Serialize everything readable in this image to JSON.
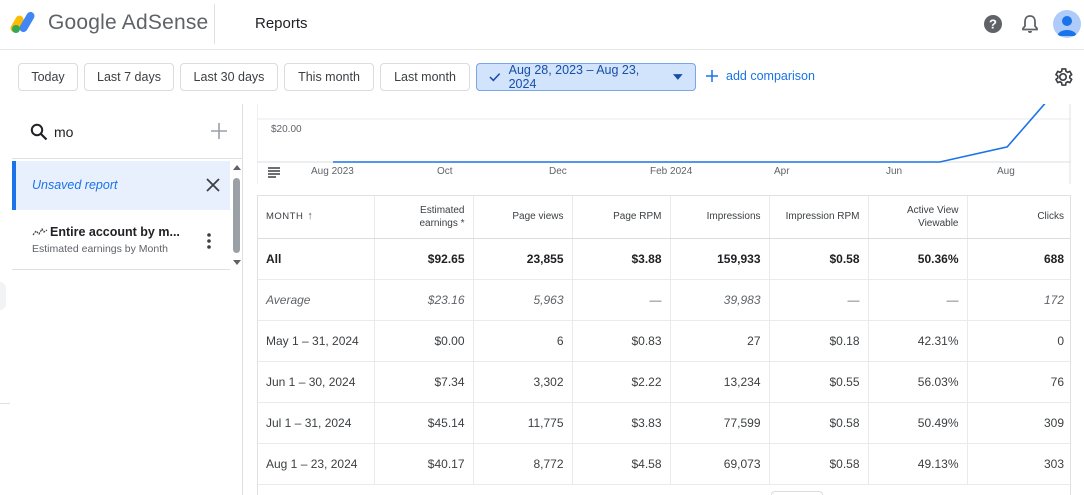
{
  "header": {
    "brand": "Google AdSense",
    "page_title": "Reports",
    "icons": [
      "help-icon",
      "notifications-icon",
      "account-avatar"
    ]
  },
  "filters": {
    "chips": [
      "Today",
      "Last 7 days",
      "Last 30 days",
      "This month",
      "Last month"
    ],
    "active_range": "Aug 28, 2023 – Aug 23, 2024",
    "add_comparison": "add comparison"
  },
  "left_panel": {
    "search_value": "mo",
    "unsaved_report": "Unsaved report",
    "saved_report_title": "Entire account by m...",
    "saved_report_subtitle": "Estimated earnings by Month"
  },
  "chart_data": {
    "type": "line",
    "y_tick_label": "$20.00",
    "x_ticks": [
      "Aug 2023",
      "Oct",
      "Dec",
      "Feb 2024",
      "Apr",
      "Jun",
      "Aug"
    ],
    "series": [
      {
        "values": [
          0,
          0,
          0,
          0,
          0,
          0,
          0,
          0,
          0,
          0.0,
          7.34,
          45.14,
          40.17
        ]
      }
    ],
    "color": "#1a73e8"
  },
  "table": {
    "columns": [
      "MONTH",
      "Estimated earnings *",
      "Page views",
      "Page RPM",
      "Impressions",
      "Impression RPM",
      "Active View Viewable",
      "Clicks"
    ],
    "total": [
      "All",
      "$92.65",
      "23,855",
      "$3.88",
      "159,933",
      "$0.58",
      "50.36%",
      "688"
    ],
    "average": [
      "Average",
      "$23.16",
      "5,963",
      "—",
      "39,983",
      "—",
      "—",
      "172"
    ],
    "rows": [
      [
        "May 1 – 31, 2024",
        "$0.00",
        "6",
        "$0.83",
        "27",
        "$0.18",
        "42.31%",
        "0"
      ],
      [
        "Jun 1 – 30, 2024",
        "$7.34",
        "3,302",
        "$2.22",
        "13,234",
        "$0.55",
        "56.03%",
        "76"
      ],
      [
        "Jul 1 – 31, 2024",
        "$45.14",
        "11,775",
        "$3.83",
        "77,599",
        "$0.58",
        "50.49%",
        "309"
      ],
      [
        "Aug 1 – 23, 2024",
        "$40.17",
        "8,772",
        "$4.58",
        "69,073",
        "$0.58",
        "49.13%",
        "303"
      ]
    ]
  }
}
